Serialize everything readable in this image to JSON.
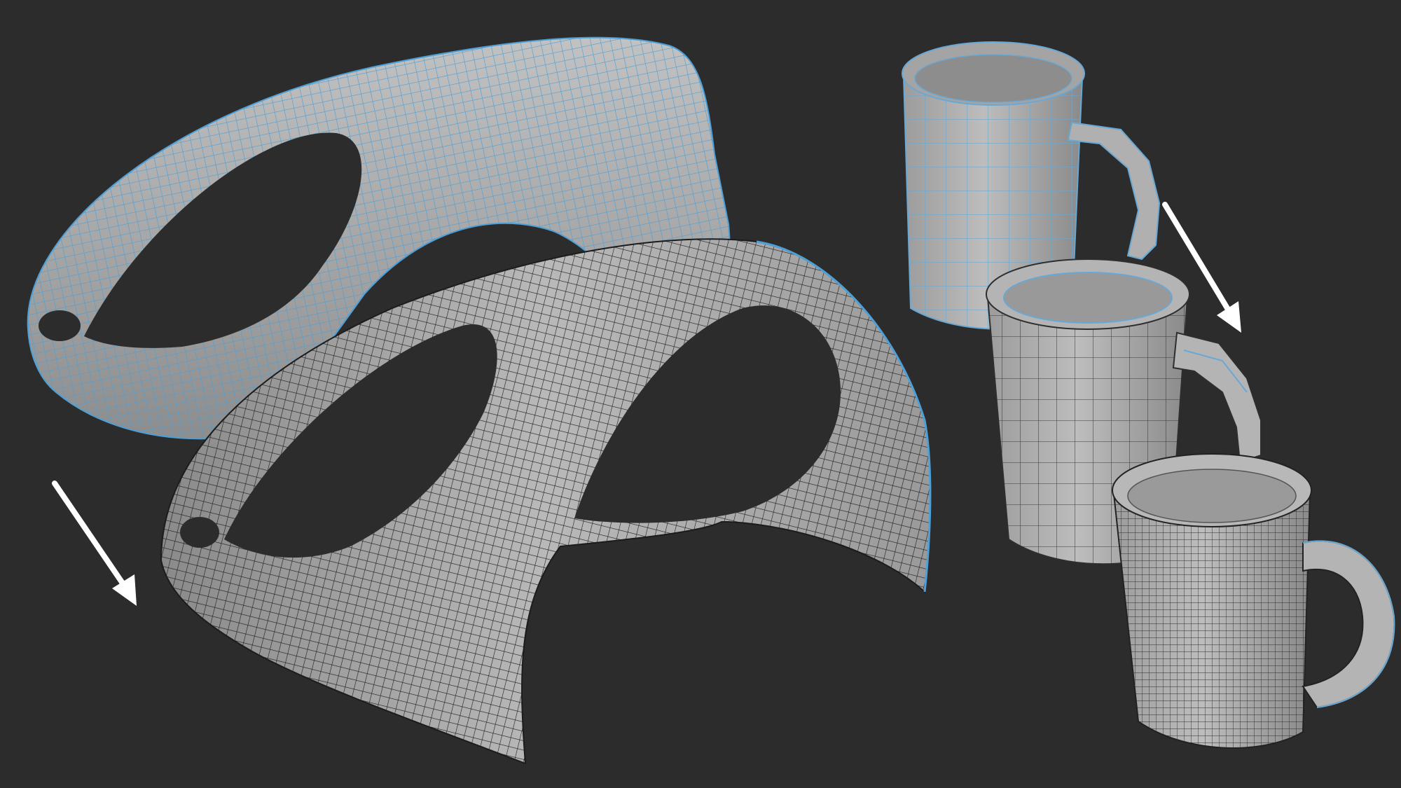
{
  "scene": {
    "background": "#2c2c2c",
    "surface_color": "#a9a9a9",
    "surface_shadow": "#7f7f7f",
    "wire_source": "#4d9fd6",
    "wire_result": "#1c1c1c",
    "arrow_color": "#ffffff"
  },
  "objects": [
    {
      "name": "wireframe-arch-source",
      "wire": "blue"
    },
    {
      "name": "wireframe-arch-result",
      "wire": "dark"
    },
    {
      "name": "mug-lowpoly",
      "wire": "blue"
    },
    {
      "name": "mug-thickened",
      "wire": "mixed"
    },
    {
      "name": "mug-smoothed",
      "wire": "dark"
    }
  ],
  "arrows": [
    {
      "name": "arrow-left",
      "icon": "arrow-down-right-icon"
    },
    {
      "name": "arrow-right",
      "icon": "arrow-down-right-icon"
    }
  ]
}
